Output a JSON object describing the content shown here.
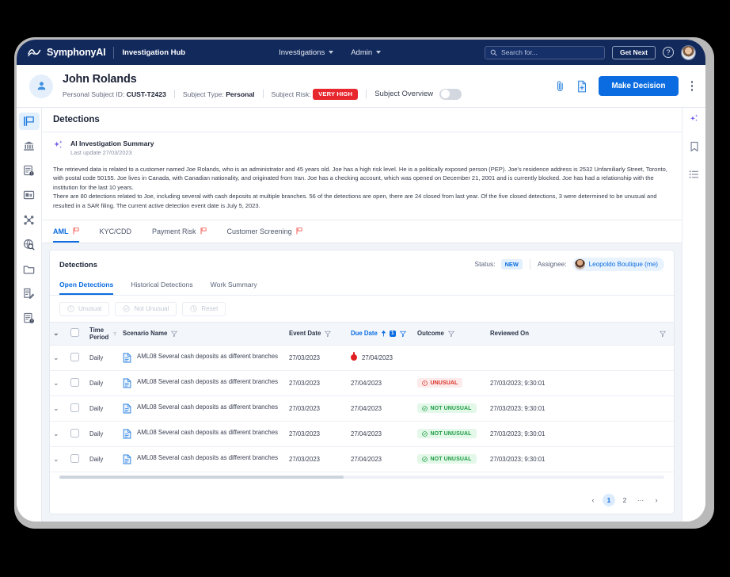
{
  "topnav": {
    "brand": "SymphonyAI",
    "product": "Investigation Hub",
    "menus": [
      {
        "label": "Investigations"
      },
      {
        "label": "Admin"
      }
    ],
    "search_placeholder": "Search for...",
    "get_next_label": "Get Next",
    "help_icon": "?",
    "colors": {
      "bar": "#12295c",
      "accent": "#0a6ce0"
    }
  },
  "subject": {
    "name": "John Rolands",
    "id_label": "Personal Subject ID:",
    "id_value": "CUST-T2423",
    "type_label": "Subject Type:",
    "type_value": "Personal",
    "risk_label": "Subject Risk:",
    "risk_value": "VERY HIGH",
    "risk_color": "#e8262d",
    "overview_label": "Subject Overview",
    "overview_on": false,
    "make_decision_label": "Make Decision"
  },
  "left_rail": [
    {
      "name": "flag-icon",
      "active": true
    },
    {
      "name": "bank-icon",
      "active": false
    },
    {
      "name": "document-alert-icon",
      "active": false
    },
    {
      "name": "transaction-monitor-icon",
      "active": false
    },
    {
      "name": "network-graph-icon",
      "active": false
    },
    {
      "name": "globe-search-icon",
      "active": false
    },
    {
      "name": "folder-icon",
      "active": false
    },
    {
      "name": "document-edit-icon",
      "active": false
    },
    {
      "name": "clipboard-alert-icon",
      "active": false
    }
  ],
  "right_rail": [
    {
      "name": "ai-sparkle-icon"
    },
    {
      "name": "bookmark-icon"
    },
    {
      "name": "list-icon"
    }
  ],
  "page": {
    "title": "Detections"
  },
  "ai_summary": {
    "title": "AI Investigation Summary",
    "last_update": "Last update 27/03/2023",
    "paragraphs": [
      "The retrieved data is related to a customer named Joe Rolands, who is an administrator and 45 years old.  Joe has a high risk level. He is a politically exposed person (PEP). Joe's residence address is 2532 Unfamiliarly Street, Toronto, with postal code 50155. Joe lives in Canada, with  Canadian nationality, and originated from Iran.  Joe has a checking account, which was opened on December 21, 2001 and is currently blocked. Joe has had a relationship with the institution for the last 10 years.",
      "There are 80 detections related to Joe, including several with cash deposits at multiple branches. 56 of the detections are open, there are 24 closed from last year. Of the five closed detections, 3 were determined to be unusual and resulted in a SAR filing.  The current active detection event date is July 5, 2023."
    ]
  },
  "risk_tabs": [
    {
      "label": "AML",
      "flag": true,
      "active": true
    },
    {
      "label": "KYC/CDD",
      "flag": false,
      "active": false
    },
    {
      "label": "Payment Risk",
      "flag": true,
      "active": false
    },
    {
      "label": "Customer Screening",
      "flag": true,
      "active": false
    }
  ],
  "detections": {
    "title": "Detections",
    "status_label": "Status:",
    "status_value": "NEW",
    "assignee_label": "Assignee:",
    "assignee_name": "Leopoldo Boutique (me)",
    "tabs": [
      {
        "label": "Open Detections",
        "active": true
      },
      {
        "label": "Historical Detections",
        "active": false
      },
      {
        "label": "Work Summary",
        "active": false
      }
    ],
    "actions": [
      {
        "label": "Unusual",
        "icon": "alert-circle-icon"
      },
      {
        "label": "Not Unusual",
        "icon": "check-circle-icon"
      },
      {
        "label": "Reset",
        "icon": "reset-icon"
      }
    ],
    "columns": [
      {
        "key": "time_period",
        "label": "Time Period",
        "filter": true
      },
      {
        "key": "scenario",
        "label": "Scenario Name",
        "filter": true
      },
      {
        "key": "event_date",
        "label": "Event Date",
        "filter": true
      },
      {
        "key": "due_date",
        "label": "Due Date",
        "filter": true,
        "sorted": true,
        "sort_order": "1"
      },
      {
        "key": "outcome",
        "label": "Outcome",
        "filter": true
      },
      {
        "key": "reviewed_on",
        "label": "Reviewed On",
        "filter": true
      }
    ],
    "rows": [
      {
        "time_period": "Daily",
        "scenario": "AML08 Several cash deposits as different branches",
        "event_date": "27/03/2023",
        "due_date": "27/04/2023",
        "due_alert": true,
        "outcome": "",
        "reviewed_on": ""
      },
      {
        "time_period": "Daily",
        "scenario": "AML08 Several cash deposits as different branches",
        "event_date": "27/03/2023",
        "due_date": "27/04/2023",
        "due_alert": false,
        "outcome": "UNUSUAL",
        "outcome_kind": "unusual",
        "reviewed_on": "27/03/2023; 9:30:01"
      },
      {
        "time_period": "Daily",
        "scenario": "AML08 Several cash deposits as different branches",
        "event_date": "27/03/2023",
        "due_date": "27/04/2023",
        "due_alert": false,
        "outcome": "NOT UNUSUAL",
        "outcome_kind": "notunusual",
        "reviewed_on": "27/03/2023; 9:30:01"
      },
      {
        "time_period": "Daily",
        "scenario": "AML08 Several cash deposits as different branches",
        "event_date": "27/03/2023",
        "due_date": "27/04/2023",
        "due_alert": false,
        "outcome": "NOT UNUSUAL",
        "outcome_kind": "notunusual",
        "reviewed_on": "27/03/2023; 9:30:01"
      },
      {
        "time_period": "Daily",
        "scenario": "AML08 Several cash deposits as different branches",
        "event_date": "27/03/2023",
        "due_date": "27/04/2023",
        "due_alert": false,
        "outcome": "NOT UNUSUAL",
        "outcome_kind": "notunusual",
        "reviewed_on": "27/03/2023; 9:30:01"
      }
    ],
    "pagination": {
      "prev": "‹",
      "pages": [
        "1",
        "2"
      ],
      "ellipsis": "···",
      "next": "›",
      "current": "1"
    }
  }
}
